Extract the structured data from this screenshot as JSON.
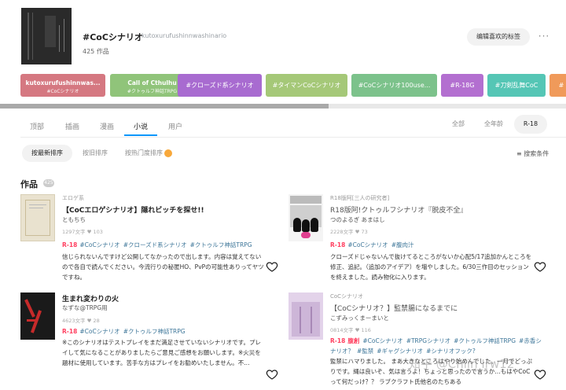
{
  "header": {
    "tag_name": "#CoCシナリオ",
    "tag_romaji": "kutoxurufushinnwashinario",
    "works_count": "425 作品",
    "edit_button": "编辑喜欢的标签",
    "more_label": "···"
  },
  "tag_chips": [
    {
      "label": "kutoxurufushinnwas...",
      "sub": "#CoCシナリオ",
      "color": "#d57881"
    },
    {
      "label": "Call of Cthulhu",
      "sub": "#クトゥルフ神話TRPG",
      "color": "#90c47a"
    },
    {
      "label": "#クローズド系シナリオ",
      "sub": "",
      "color": "#a86bd0"
    },
    {
      "label": "#タイマンCoCシナリオ",
      "sub": "",
      "color": "#a5c878"
    },
    {
      "label": "#CoCシナリオ100use...",
      "sub": "",
      "color": "#7cc28b"
    },
    {
      "label": "#R-18G",
      "sub": "",
      "color": "#b36fd0"
    },
    {
      "label": "#刀剣乱舞CoC",
      "sub": "",
      "color": "#55c6b5"
    },
    {
      "label": "#",
      "sub": "",
      "color": "#f09a5a"
    }
  ],
  "scroll_progress": 0.58,
  "nav": {
    "tabs": [
      "顶部",
      "插画",
      "漫画",
      "小说",
      "用户"
    ],
    "active_tab": 3,
    "age_filters": [
      "全部",
      "全年龄",
      "R-18"
    ],
    "active_age": 2
  },
  "sort": {
    "options": [
      "按最新排序",
      "按旧排序",
      "按热门度排序"
    ],
    "active": 0,
    "search_conditions": "≡ 搜索条件"
  },
  "works": {
    "title": "作品",
    "count": "425"
  },
  "cards": [
    {
      "series": "エロゲ系",
      "title": "【CoCエロゲシナリオ】隠れビッチを探せ!!",
      "author": "ともちち",
      "stats": "1297文字 ♥ 103",
      "r18": "R-18",
      "tags": [
        "#CoCシナリオ",
        "#クローズド系シナリオ",
        "#クトゥルフ神話TRPG"
      ],
      "desc": "信じられないんですけど公開してなかったので出します。内容は覚えてないので各自で読んでください。今流行りの秘匿HO、PvPの可能性ありってヤツですね。"
    },
    {
      "series": "R18版阿[三人の研究者]",
      "title": "R18版阿!クトゥルフシナリオ『脱皮不全』",
      "author": "つのよるぎ あまはし",
      "stats": "2228文字 ♥ 73",
      "r18": "R-18",
      "tags": [
        "#CoCシナリオ",
        "#腹肉汁"
      ],
      "desc": "クローズドじゃないんで抜けてるところがないか心配5/17追加かんところを修正、追記。（追加のアイデア）を増やしました。6/30三作目のセッションを終えました。読み物化に入ります。"
    },
    {
      "series": "",
      "title": "生まれ変わりの火",
      "author": "なずな@TRPG用",
      "stats": "4623文字 ♥ 28",
      "r18": "R-18",
      "tags": [
        "#CoCシナリオ",
        "#クトゥルフ神話TRPG"
      ],
      "desc": "※このシナリオはテストプレイをまだ満足させていないシナリオです。プレイして気になることがありましたらご意見ご感想をお願いします。※火災を題材に使用しています。苦手な方はプレイをお勧めいたしません。不..."
    },
    {
      "series": "CoCシナリオ",
      "title": "【CoCシナリオ？】監禁腸になるまでに",
      "author": "こずみっくまーまいと",
      "stats": "0814文字 ♥ 116",
      "r18": "R-18",
      "tags": [
        "腹創",
        "#CoCシナリオ",
        "#TRPGシナリオ",
        "#クトゥルフ神話TRPG",
        "#赤香シナリオ？",
        "#監禁",
        "#ギャグシナリオ",
        "#シナリオフック?"
      ],
      "desc": "監禁にハマりました。 まあ大きなところはやり始めんでした。一月でどっぷりです。縄は良いぞ、気は言うよ！ちょっと思ったので言うか…もはやCoCって何だっけ？？ ラブクラフト氏他名のたちある"
    }
  ],
  "watermark": "知乎 @Chiin Irw12",
  "colors": {
    "accent": "#0096fa",
    "r18": "#ff4060",
    "tag_link": "#3d7699"
  }
}
